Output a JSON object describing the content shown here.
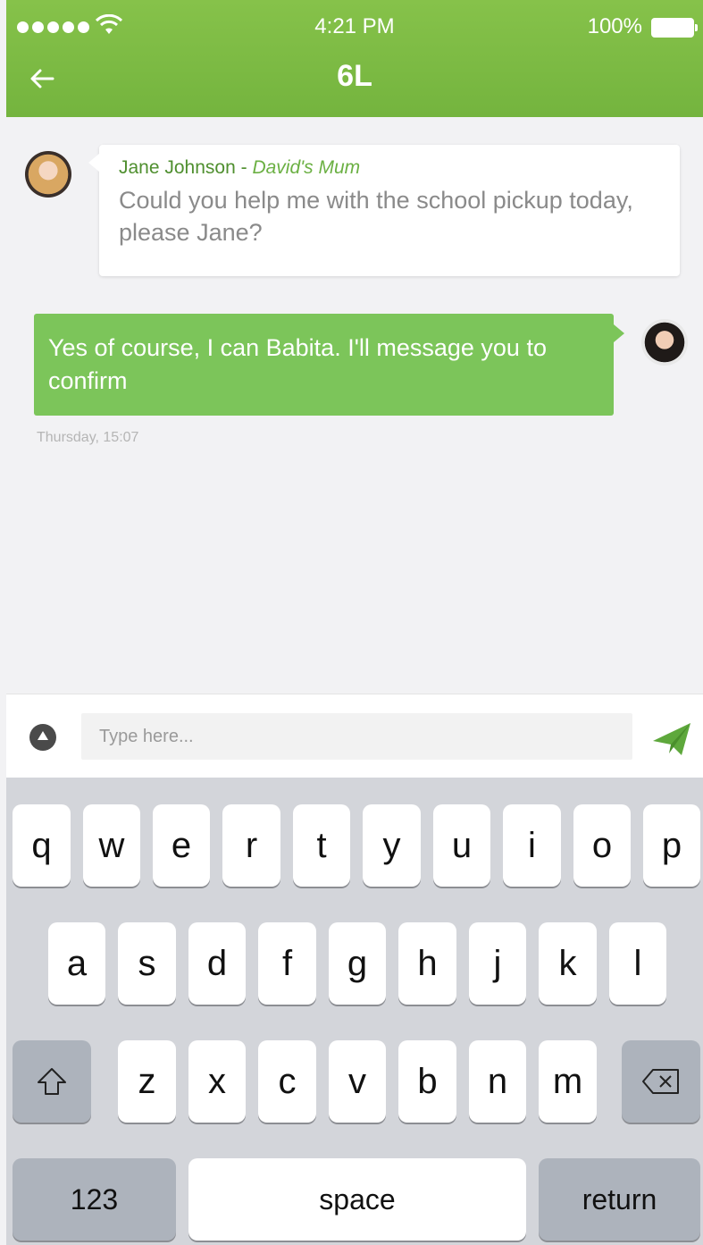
{
  "status_bar": {
    "time": "4:21 PM",
    "battery": "100%"
  },
  "header": {
    "title": "6L"
  },
  "messages": [
    {
      "sender": "Jane Johnson",
      "separator": " - ",
      "relation": "David's Mum",
      "text": "Could you help me with the school pickup today, please Jane?"
    },
    {
      "text": "Yes of course, I can Babita. I'll message you to confirm",
      "timestamp": "Thursday, 15:07"
    }
  ],
  "composer": {
    "placeholder": "Type here..."
  },
  "keyboard": {
    "row1": [
      "q",
      "w",
      "e",
      "r",
      "t",
      "y",
      "u",
      "i",
      "o",
      "p"
    ],
    "row2": [
      "a",
      "s",
      "d",
      "f",
      "g",
      "h",
      "j",
      "k",
      "l"
    ],
    "row3": [
      "z",
      "x",
      "c",
      "v",
      "b",
      "n",
      "m"
    ],
    "numbers_label": "123",
    "space_label": "space",
    "return_label": "return"
  },
  "colors": {
    "brand_green": "#7cc55a",
    "header_green": "#7dbb44"
  }
}
